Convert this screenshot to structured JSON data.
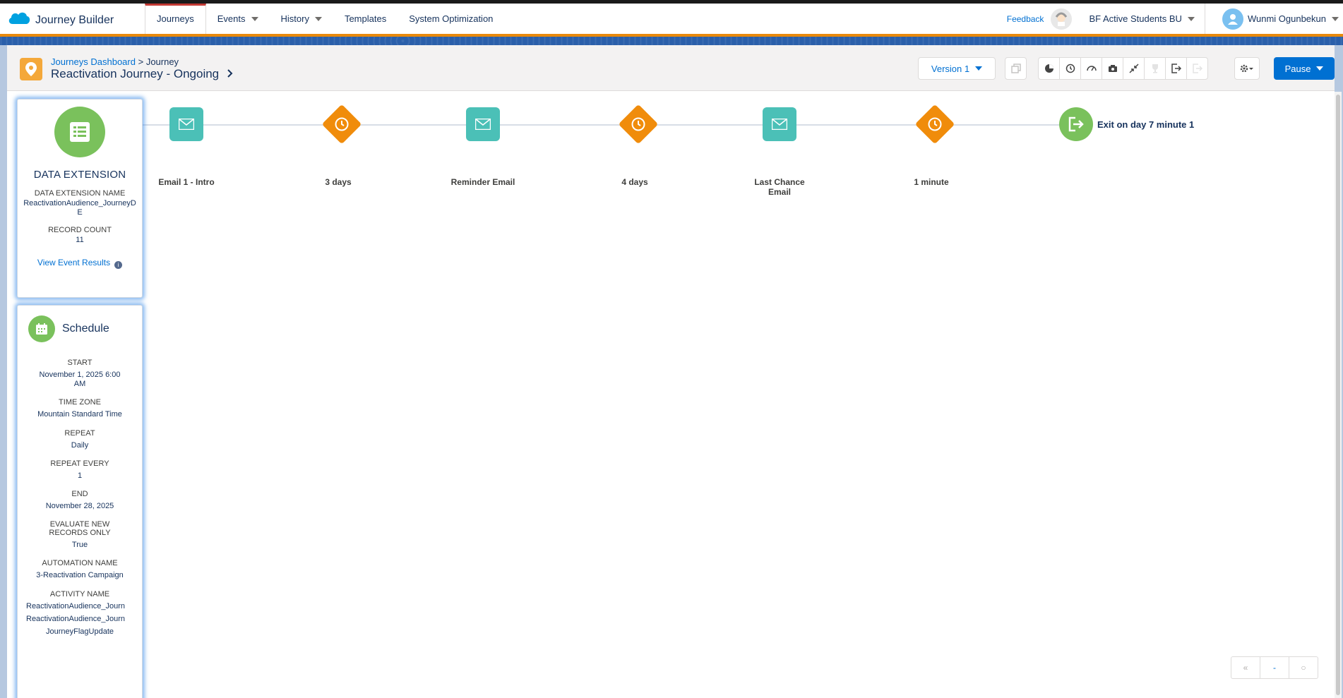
{
  "app": {
    "brand_title": "Journey Builder",
    "nav_tabs": [
      {
        "label": "Journeys",
        "active": true,
        "dropdown": false
      },
      {
        "label": "Events",
        "active": false,
        "dropdown": true
      },
      {
        "label": "History",
        "active": false,
        "dropdown": true
      },
      {
        "label": "Templates",
        "active": false,
        "dropdown": false
      },
      {
        "label": "System Optimization",
        "active": false,
        "dropdown": false
      }
    ],
    "feedback_label": "Feedback",
    "business_unit": "BF Active Students BU",
    "user_name": "Wunmi Ogunbekun"
  },
  "header": {
    "breadcrumb_link": "Journeys Dashboard",
    "breadcrumb_separator": ">",
    "breadcrumb_current": "Journey",
    "journey_title": "Reactivation Journey - Ongoing",
    "version_label": "Version 1",
    "tools": [
      "copy-icon",
      "pie-chart-icon",
      "history-icon",
      "gauge-icon",
      "camera-icon",
      "collapse-icon",
      "trophy-icon",
      "exit-icon",
      "exit-disabled-icon",
      "settings-icon"
    ],
    "pause_label": "Pause"
  },
  "entry_source": {
    "title": "DATA EXTENSION",
    "name_label": "DATA EXTENSION NAME",
    "name_value": "ReactivationAudience_JourneyDE",
    "count_label": "RECORD COUNT",
    "count_value": "11",
    "view_results_label": "View Event Results"
  },
  "schedule": {
    "title": "Schedule",
    "fields": [
      {
        "label": "START",
        "value": "November 1, 2025 6:00 AM"
      },
      {
        "label": "TIME ZONE",
        "value": "Mountain Standard Time"
      },
      {
        "label": "REPEAT",
        "value": "Daily"
      },
      {
        "label": "REPEAT EVERY",
        "value": "1"
      },
      {
        "label": "END",
        "value": "November 28, 2025"
      },
      {
        "label": "EVALUATE NEW RECORDS ONLY",
        "value": "True"
      },
      {
        "label": "AUTOMATION NAME",
        "value": "3-Reactivation Campaign"
      }
    ],
    "activity_label": "ACTIVITY NAME",
    "activity_values": [
      "ReactivationAudience_Journ",
      "ReactivationAudience_Journ",
      "JourneyFlagUpdate"
    ]
  },
  "journey_path": [
    {
      "type": "email",
      "label": "Email 1 - Intro"
    },
    {
      "type": "wait",
      "label": "3 days"
    },
    {
      "type": "email",
      "label": "Reminder Email"
    },
    {
      "type": "wait",
      "label": "4 days"
    },
    {
      "type": "email",
      "label": "Last Chance Email"
    },
    {
      "type": "wait",
      "label": "1 minute"
    },
    {
      "type": "exit",
      "label": "Exit on day 7 minute 1"
    }
  ],
  "zoom": {
    "zoom_out_label": "«",
    "zoom_level_label": "-",
    "zoom_in_label": "○"
  },
  "colors": {
    "accent": "#0070d2",
    "email_activity": "#4bc0b7",
    "wait_activity": "#f08c0b",
    "entry_green": "#7ac15c"
  }
}
